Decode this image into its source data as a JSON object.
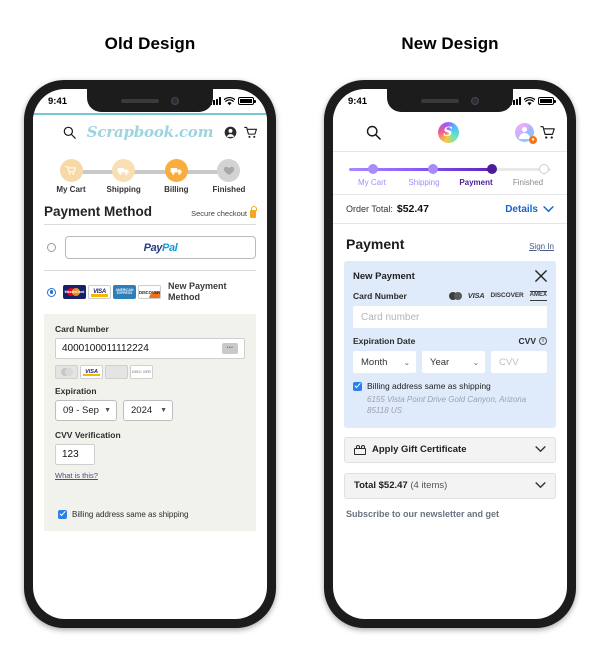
{
  "captions": {
    "old": "Old Design",
    "new": "New Design"
  },
  "status_bar": {
    "time": "9:41",
    "signal_icon": "signal-bars-icon",
    "wifi_icon": "wifi-icon",
    "battery_icon": "battery-icon"
  },
  "old": {
    "header": {
      "menu_icon": "hamburger-menu-icon",
      "search_icon": "search-icon",
      "logo_text": "Scrapbook.com",
      "account_icon": "account-icon",
      "cart_icon": "shopping-cart-icon"
    },
    "steps": [
      {
        "label": "My Cart",
        "icon": "cart-icon",
        "state": "done",
        "color": "#f7d9a8"
      },
      {
        "label": "Shipping",
        "icon": "truck-icon",
        "state": "done",
        "color": "#f8dfb4"
      },
      {
        "label": "Billing",
        "icon": "truck-icon",
        "state": "active",
        "color": "#f9ad3c"
      },
      {
        "label": "Finished",
        "icon": "heart-icon",
        "state": "todo",
        "color": "#d3d3d3"
      }
    ],
    "section": {
      "title": "Payment Method",
      "secure_text": "Secure checkout",
      "lock_icon": "lock-icon"
    },
    "paypal": {
      "selected": false,
      "label_a": "Pay",
      "label_b": "Pal",
      "radio_name": "paypal-radio"
    },
    "new_method": {
      "selected": true,
      "label": "New Payment Method",
      "brands": [
        "MasterCard",
        "VISA",
        "AMERICAN EXPRESS",
        "DISCOVER"
      ]
    },
    "form": {
      "card_number_label": "Card Number",
      "card_number_value": "4000100011112224",
      "cvv_chip_icon": "cvv-hint-icon",
      "expiration_label": "Expiration",
      "month_value": "09 - Sep",
      "year_value": "2024",
      "cvv_label": "CVV Verification",
      "cvv_value": "123",
      "what_is_this": "What is this?"
    },
    "billing": {
      "checked": true,
      "label": "Billing address same as shipping"
    }
  },
  "new": {
    "header": {
      "menu_icon": "hamburger-menu-icon",
      "search_icon": "search-icon",
      "logo_icon": "scrapbook-s-logo-icon",
      "logo_letter": "S",
      "account_icon": "account-avatar-icon",
      "notification_icon": "bell-icon",
      "cart_icon": "shopping-cart-icon"
    },
    "steps": [
      {
        "label": "My Cart",
        "state": "done"
      },
      {
        "label": "Shipping",
        "state": "done"
      },
      {
        "label": "Payment",
        "state": "current"
      },
      {
        "label": "Finished",
        "state": "todo"
      }
    ],
    "order_bar": {
      "label": "Order Total:",
      "amount": "$52.47",
      "details_label": "Details",
      "chevron_icon": "chevron-down-icon"
    },
    "payment_head": {
      "title": "Payment",
      "signin": "Sign In"
    },
    "card": {
      "title": "New Payment",
      "close_icon": "close-icon",
      "card_number_label": "Card Number",
      "card_number_placeholder": "Card number",
      "brands": [
        "mastercard-icon",
        "VISA",
        "DISCOVER",
        "AMEX"
      ],
      "expiration_label": "Expiration Date",
      "month_placeholder": "Month",
      "year_placeholder": "Year",
      "cvv_label": "CVV",
      "cvv_info_icon": "info-icon",
      "cvv_placeholder": "CVV",
      "billing_checked": true,
      "billing_label": "Billing address same as shipping",
      "billing_address": "6155 Vista Point Drive Gold Canyon, Arizona 85118 US"
    },
    "gift": {
      "label": "Apply Gift Certificate",
      "icon": "gift-certificate-icon",
      "chevron_icon": "chevron-down-icon"
    },
    "total": {
      "label": "Total $52.47",
      "items": "(4 items)",
      "chevron_icon": "chevron-down-icon"
    },
    "newsletter": "Subscribe to our newsletter and get"
  },
  "colors": {
    "old_accent": "#f9ad3c",
    "old_brand": "#9ed3e0",
    "new_accent": "#4c1d95",
    "link": "#1666c8"
  }
}
